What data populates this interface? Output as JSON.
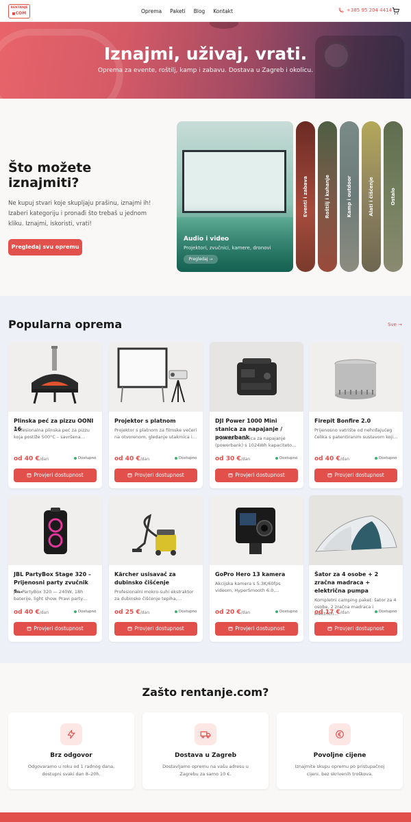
{
  "header": {
    "logo_top": "RENTANJE",
    "logo_bottom": "COM",
    "nav": [
      "Oprema",
      "Paketi",
      "Blog",
      "Kontakt"
    ],
    "phone": "+385 95 204 4414",
    "cart_icon": "cart-icon"
  },
  "hero": {
    "title": "Iznajmi, uživaj, vrati.",
    "subtitle": "Oprema za evente, roštilj, kamp i zabavu. Dostava u Zagreb i okolicu."
  },
  "categories": {
    "title": "Što možete iznajmiti?",
    "text": "Ne kupuj stvari koje skupljaju prašinu, iznajmi ih! Izaberi kategoriju i pronađi što trebaš u jednom kliku. Iznajmi, iskoristi, vrati!",
    "button": "Pregledaj svu opremu",
    "featured": {
      "title": "Audio i video",
      "subtitle": "Projektori, zvučnici, kamere, dronovi",
      "button": "Pregledaj →"
    },
    "strips": [
      {
        "label": "Eventi i zabava",
        "color": "#8a3a32"
      },
      {
        "label": "Roštilj i kuhanje",
        "color": "#5a6e4e"
      },
      {
        "label": "Kamp i outdoor",
        "color": "#7d8a86"
      },
      {
        "label": "Alati i čišćenje",
        "color": "#8f8460"
      },
      {
        "label": "Ostalo",
        "color": "#5f6d4f"
      }
    ]
  },
  "popular": {
    "title": "Popularna oprema",
    "all_link": "Sve →",
    "price_prefix": "od",
    "price_unit": "/dan",
    "availability": "Dostupno",
    "cta": "Provjeri dostupnost",
    "products": [
      {
        "title": "Plinska peć za pizzu OONI 16",
        "desc": "Profesionalna plinska peć za pizzu koja postiže 500°C – savršena…",
        "price": "40 €",
        "image": "pizza-oven-icon"
      },
      {
        "title": "Projektor s platnom",
        "desc": "Projektor s platnom za filmske večeri na otvorenom, gledanje utakmica i…",
        "price": "40 €",
        "image": "projector-screen-icon"
      },
      {
        "title": "DJI Power 1000 Mini stanica za napajanje / powerbank",
        "desc": "Prijenosna stanica za napajanje (powerbank) s 1024Wh kapaciteto…",
        "price": "30 €",
        "image": "power-station-icon"
      },
      {
        "title": "Firepit Bonfire 2.0",
        "desc": "Prijenosno vatrište od nehrđajućeg čelika s patentiranim sustavom koji…",
        "price": "40 €",
        "image": "firepit-icon"
      },
      {
        "title": "JBL PartyBox Stage 320 – Prijenosni party zvučnik s…",
        "desc": "JBL PartyBox 320 — 240W, 18h baterije, light show. Pravi party…",
        "price": "40 €",
        "image": "speaker-icon"
      },
      {
        "title": "Kärcher usisavač za dubinsko čišćenje",
        "desc": "Profesionalni mokro-suhi ekstraktor za dubinsko čišćenje tepiha,…",
        "price": "25 €",
        "image": "vacuum-icon"
      },
      {
        "title": "GoPro Hero 13 kamera",
        "desc": "Akcijska kamera s 5.3K/60fps videom, HyperSmooth 6.0,…",
        "price": "20 €",
        "image": "action-camera-icon"
      },
      {
        "title": "Šator za 4 osobe + 2 zračna madraca + električna pumpa",
        "desc": "Kompletni camping paket: šator za 4 osobe, 2 zračna madraca i električn…",
        "price": "17 €",
        "image": "tent-icon"
      }
    ]
  },
  "why": {
    "title": "Zašto rentanje.com?",
    "items": [
      {
        "title": "Brz odgovor",
        "desc": "Odgovaramo u roku od 1 radnog dana, dostupni svaki dan 8–20h.",
        "icon": "lightning-icon"
      },
      {
        "title": "Dostava u Zagreb",
        "desc": "Dostavljamo opremu na vašu adresu u Zagrebu za samo 10 €.",
        "icon": "truck-icon"
      },
      {
        "title": "Povoljne cijene",
        "desc": "Iznajmite skupu opremu po pristupačnoj cijeni, bez skrivenih troškova.",
        "icon": "euro-coin-icon"
      }
    ]
  },
  "colors": {
    "accent": "#e2504c",
    "available": "#3bb273"
  }
}
